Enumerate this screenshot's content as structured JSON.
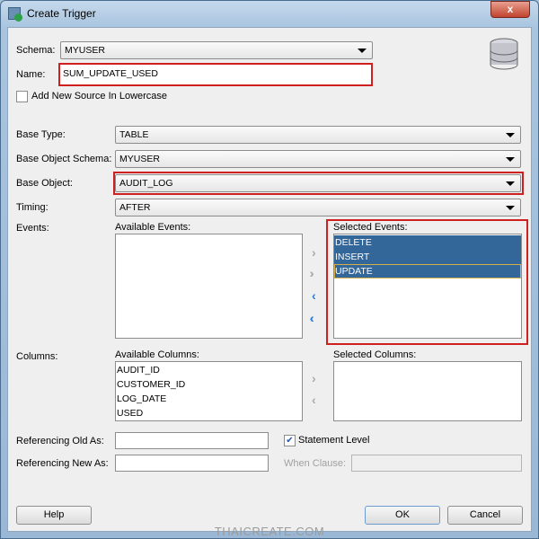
{
  "window": {
    "title": "Create Trigger",
    "close": "x"
  },
  "form": {
    "schema_label": "Schema:",
    "schema_value": "MYUSER",
    "name_label": "Name:",
    "name_value": "SUM_UPDATE_USED",
    "lowercase_label": "Add New Source In Lowercase",
    "lowercase_checked": false,
    "base_type_label": "Base Type:",
    "base_type_value": "TABLE",
    "base_object_schema_label": "Base Object Schema:",
    "base_object_schema_value": "MYUSER",
    "base_object_label": "Base Object:",
    "base_object_value": "AUDIT_LOG",
    "timing_label": "Timing:",
    "timing_value": "AFTER",
    "events_label": "Events:",
    "available_events_label": "Available Events:",
    "available_events": [],
    "selected_events_label": "Selected Events:",
    "selected_events": [
      "DELETE",
      "INSERT",
      "UPDATE"
    ],
    "columns_label": "Columns:",
    "available_columns_label": "Available Columns:",
    "available_columns": [
      "AUDIT_ID",
      "CUSTOMER_ID",
      "LOG_DATE",
      "USED"
    ],
    "selected_columns_label": "Selected Columns:",
    "selected_columns": [],
    "ref_old_label": "Referencing Old As:",
    "ref_old_value": "",
    "ref_new_label": "Referencing New As:",
    "ref_new_value": "",
    "statement_level_label": "Statement Level",
    "statement_level_checked": true,
    "when_clause_label": "When Clause:",
    "when_clause_value": ""
  },
  "buttons": {
    "help": "Help",
    "ok": "OK",
    "cancel": "Cancel"
  },
  "watermark": "THAICREATE.COM",
  "colors": {
    "selection": "#336699",
    "highlight_border": "#d01f1f"
  }
}
